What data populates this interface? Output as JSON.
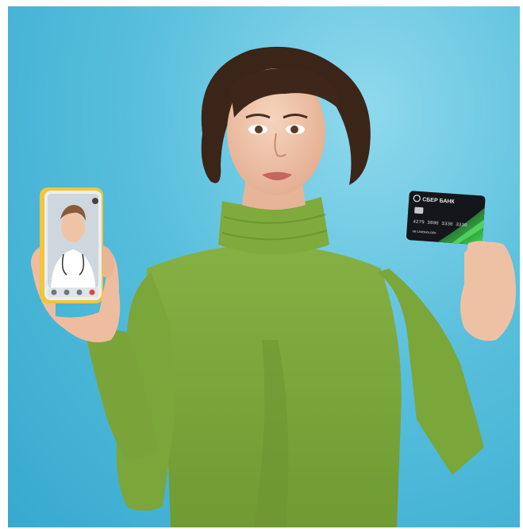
{
  "scene": {
    "description_colors": {
      "background": "#4fb8d8",
      "sweater": "#7aa43a",
      "sweater_shadow": "#5d8428",
      "skin": "#f0c7ad",
      "hair": "#3a2418",
      "phone_case": "#f2c53d",
      "card": "#15161a",
      "card_accent": "#39d04a"
    }
  },
  "card": {
    "bank_name": "СБЕР БАНК",
    "number": "4279 3800 3330 3330",
    "holder_hint": "VB   CARDHOLDER"
  },
  "phone": {
    "call_icons": [
      "mute-icon",
      "pause-icon",
      "video-icon",
      "end-call-icon"
    ]
  }
}
